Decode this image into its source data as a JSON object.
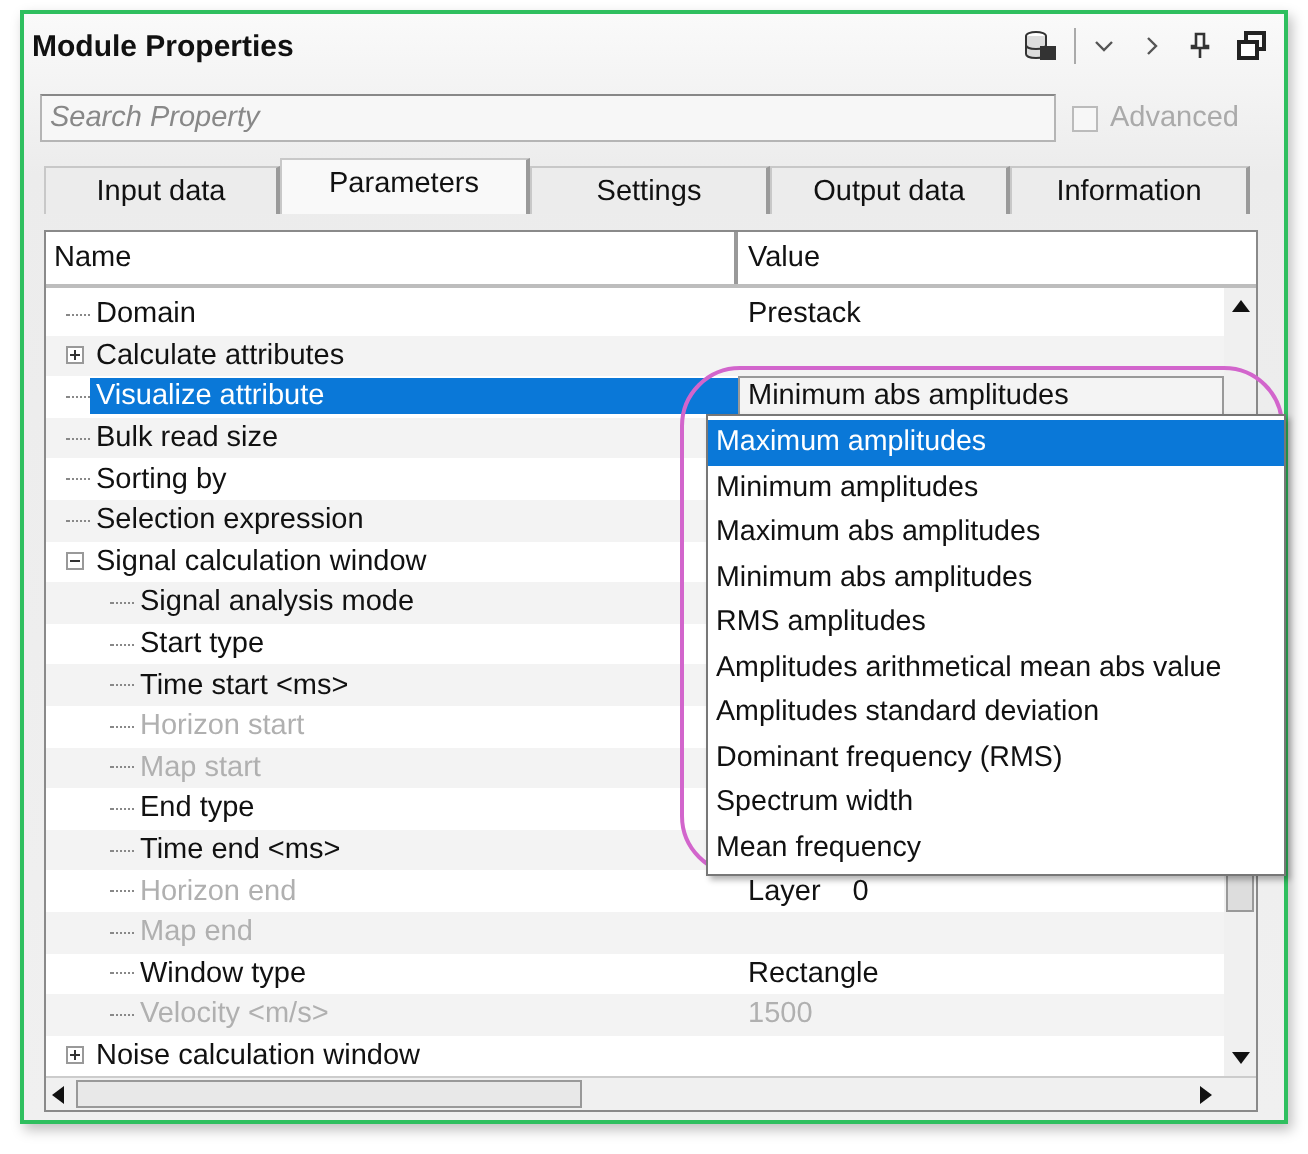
{
  "window": {
    "title": "Module Properties"
  },
  "search": {
    "placeholder": "Search Property"
  },
  "advanced": {
    "label": "Advanced",
    "checked": false,
    "disabled": true
  },
  "tabs": [
    {
      "label": "Input data",
      "selected": false
    },
    {
      "label": "Parameters",
      "selected": true
    },
    {
      "label": "Settings",
      "selected": false
    },
    {
      "label": "Output data",
      "selected": false
    },
    {
      "label": "Information",
      "selected": false
    }
  ],
  "grid": {
    "columns": [
      "Name",
      "Value"
    ],
    "rows": [
      {
        "name": "Domain",
        "value": "Prestack",
        "selected": false,
        "disabled": false
      },
      {
        "name": "Calculate attributes",
        "expanded": false,
        "selected": false,
        "disabled": false
      },
      {
        "name": "Visualize attribute",
        "value": "Minimum abs amplitudes",
        "selected": true,
        "disabled": false
      },
      {
        "name": "Bulk read size",
        "selected": false,
        "disabled": false
      },
      {
        "name": "Sorting by",
        "selected": false,
        "disabled": false
      },
      {
        "name": "Selection expression",
        "selected": false,
        "disabled": false
      },
      {
        "name": "Signal calculation window",
        "expanded": true,
        "selected": false,
        "disabled": false,
        "children": [
          {
            "name": "Signal analysis mode",
            "selected": false,
            "disabled": false
          },
          {
            "name": "Start type",
            "selected": false,
            "disabled": false
          },
          {
            "name": "Time start <ms>",
            "selected": false,
            "disabled": false
          },
          {
            "name": "Horizon start",
            "selected": false,
            "disabled": true
          },
          {
            "name": "Map start",
            "selected": false,
            "disabled": true
          },
          {
            "name": "End type",
            "selected": false,
            "disabled": false
          },
          {
            "name": "Time end <ms>",
            "selected": false,
            "disabled": false
          },
          {
            "name": "Horizon end",
            "value": "Layer",
            "value_2": "0",
            "selected": false,
            "disabled": true
          },
          {
            "name": "Map end",
            "selected": false,
            "disabled": true
          },
          {
            "name": "Window type",
            "value": "Rectangle",
            "selected": false,
            "disabled": false
          },
          {
            "name": "Velocity <m/s>",
            "value": "1500",
            "selected": false,
            "disabled": true
          }
        ]
      },
      {
        "name": "Noise calculation window",
        "expanded": false,
        "selected": false,
        "disabled": false
      }
    ]
  },
  "dropdown": {
    "options": [
      {
        "label": "Maximum amplitudes",
        "selected": true
      },
      {
        "label": "Minimum amplitudes",
        "selected": false
      },
      {
        "label": "Maximum abs amplitudes",
        "selected": false
      },
      {
        "label": "Minimum abs amplitudes",
        "selected": false
      },
      {
        "label": "RMS amplitudes",
        "selected": false
      },
      {
        "label": "Amplitudes arithmetical mean abs value",
        "selected": false
      },
      {
        "label": "Amplitudes standard deviation",
        "selected": false
      },
      {
        "label": "Dominant frequency (RMS)",
        "selected": false
      },
      {
        "label": "Spectrum width",
        "selected": false
      },
      {
        "label": "Mean frequency",
        "selected": false
      }
    ]
  }
}
